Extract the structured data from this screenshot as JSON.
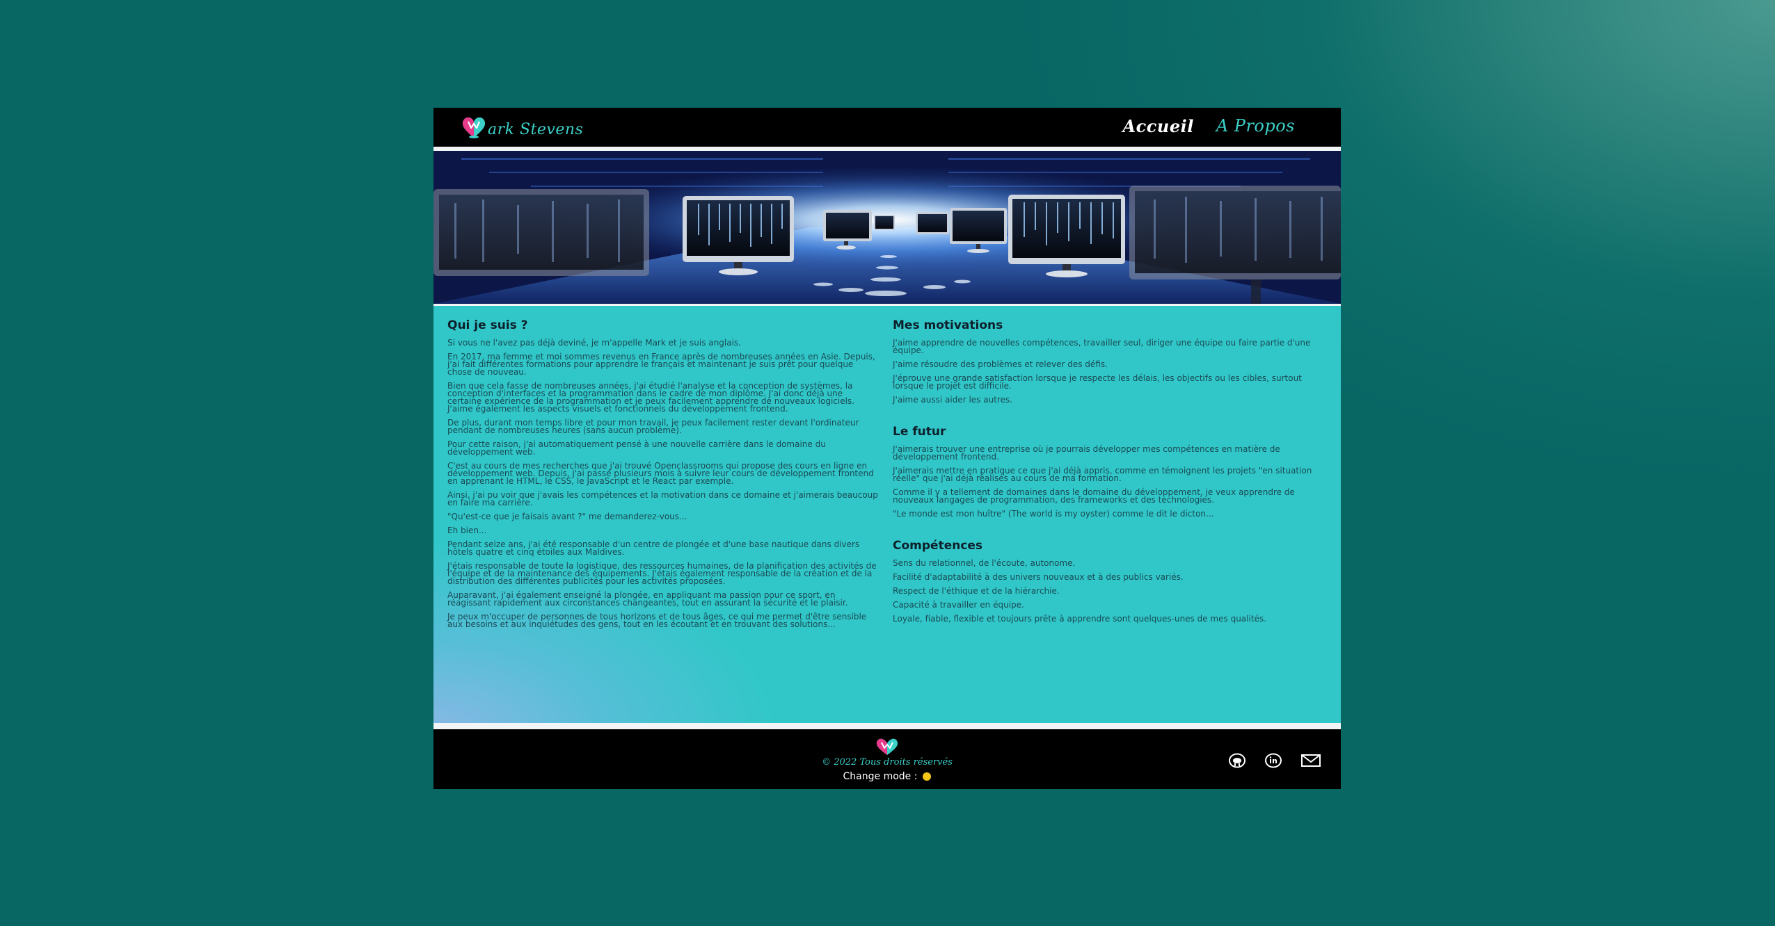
{
  "header": {
    "logo_text": "ark Stevens",
    "nav": {
      "accueil": "Accueil",
      "apropos": "A Propos"
    }
  },
  "main": {
    "left": {
      "title": "Qui je suis ?",
      "paragraphs": [
        "Si vous ne l'avez pas déjà deviné, je m'appelle Mark et je suis anglais.",
        "En 2017, ma femme et moi sommes revenus en France après de nombreuses années en Asie. Depuis, j'ai fait différentes formations pour apprendre le français et maintenant je suis prêt pour quelque chose de nouveau.",
        "Bien que cela fasse de nombreuses années, j'ai étudié l'analyse et la conception de systèmes, la conception d'interfaces et la programmation dans le cadre de mon diplôme. J'ai donc déjà une certaine expérience de la programmation et je peux facilement apprendre de nouveaux logiciels. J'aime également les aspects visuels et fonctionnels du développement frontend.",
        "De plus, durant mon temps libre et pour mon travail, je peux facilement rester devant l'ordinateur pendant de nombreuses heures (sans aucun problème).",
        "Pour cette raison, j'ai automatiquement pensé à une nouvelle carrière dans le domaine du développement web.",
        "C'est au cours de mes recherches que j'ai trouvé Openclassrooms qui propose des cours en ligne en développement web. Depuis, j'ai passé plusieurs mois à suivre leur cours de développement frontend en apprenant le HTML, le CSS, le JavaScript et le React par exemple.",
        "Ainsi, j'ai pu voir que j'avais les compétences et la motivation dans ce domaine et j'aimerais beaucoup en faire ma carrière.",
        "\"Qu'est-ce que je faisais avant ?\" me demanderez-vous...",
        "Eh bien...",
        "Pendant seize ans, j'ai été responsable d'un centre de plongée et d'une base nautique dans divers hôtels quatre et cinq étoiles aux Maldives.",
        "J'étais responsable de toute la logistique, des ressources humaines, de la planification des activités de l'équipe et de la maintenance des équipements. J'étais également responsable de la création et de la distribution des différentes publicités pour les activités proposées.",
        "Auparavant, j'ai également enseigné la plongée, en appliquant ma passion pour ce sport, en réagissant rapidement aux circonstances changeantes, tout en assurant la sécurité et le plaisir.",
        "Je peux m'occuper de personnes de tous horizons et de tous âges, ce qui me permet d'être sensible aux besoins et aux inquiétudes des gens, tout en les écoutant et en trouvant des solutions..."
      ]
    },
    "right": {
      "motivations": {
        "title": "Mes motivations",
        "paragraphs": [
          "J'aime apprendre de nouvelles compétences, travailler seul, diriger une équipe ou faire partie d'une équipe.",
          "J'aime résoudre des problèmes et relever des défis.",
          "J'éprouve une grande satisfaction lorsque je respecte les délais, les objectifs ou les cibles, surtout lorsque le projet est difficile.",
          "J'aime aussi aider les autres."
        ]
      },
      "futur": {
        "title": "Le futur",
        "paragraphs": [
          "J'aimerais trouver une entreprise où je pourrais développer mes compétences en matière de développement frontend.",
          "J'aimerais mettre en pratique ce que j'ai déjà appris, comme en témoignent les projets \"en situation réelle\" que j'ai déjà réalisés au cours de ma formation.",
          "Comme il y a tellement de domaines dans le domaine du développement, je veux apprendre de nouveaux langages de programmation, des frameworks et des technologies.",
          "\"Le monde est mon huître\" (The world is my oyster) comme le dit le dicton..."
        ]
      },
      "competences": {
        "title": "Compétences",
        "paragraphs": [
          "Sens du relationnel, de l'écoute, autonome.",
          "Facilité d'adaptabilité à des univers nouveaux et à des publics variés.",
          "Respect de l'éthique et de la hiérarchie.",
          "Capacité à travailler en équipe.",
          "Loyale, fiable, flexible et toujours prête à apprendre sont quelques-unes de mes qualités."
        ]
      }
    }
  },
  "footer": {
    "copyright": "© 2022 Tous droits réservés",
    "mode_label": "Change mode :"
  },
  "colors": {
    "accent": "#3cd0c8",
    "main_bg": "#31c7c8",
    "page_bg": "#086663",
    "toggle": "#f5c518"
  },
  "icons": {
    "logo": "heart-logo-icon",
    "social": [
      "github-icon",
      "linkedin-icon",
      "mail-icon"
    ]
  }
}
